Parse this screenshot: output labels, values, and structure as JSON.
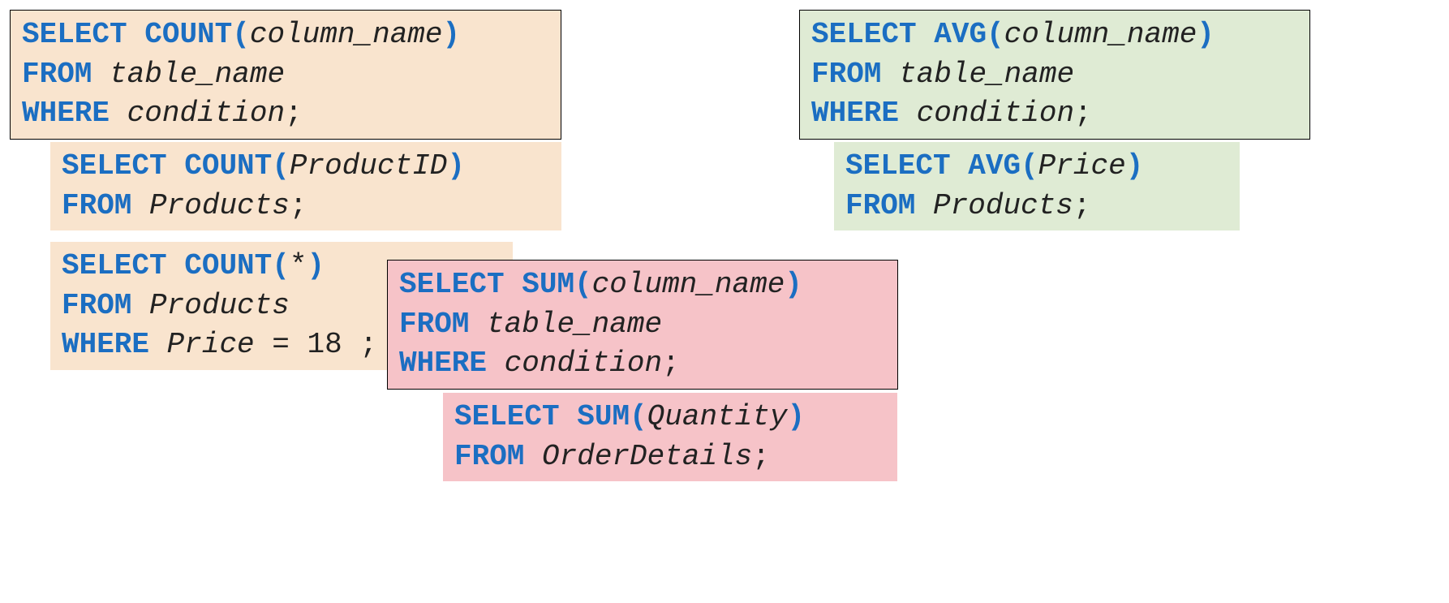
{
  "kw": {
    "select": "SELECT",
    "from": "FROM",
    "where": "WHERE",
    "count": "COUNT",
    "avg": "AVG",
    "sum": "SUM"
  },
  "id": {
    "column_name": "column_name",
    "table_name": "table_name",
    "condition": "condition",
    "ProductID": "ProductID",
    "Products": "Products",
    "Price": "Price",
    "Quantity": "Quantity",
    "OrderDetails": "OrderDetails"
  },
  "sym": {
    "lp": "(",
    "rp": ")",
    "semi": ";",
    "star": "*",
    "eq": "="
  },
  "num": {
    "n18": "18"
  }
}
